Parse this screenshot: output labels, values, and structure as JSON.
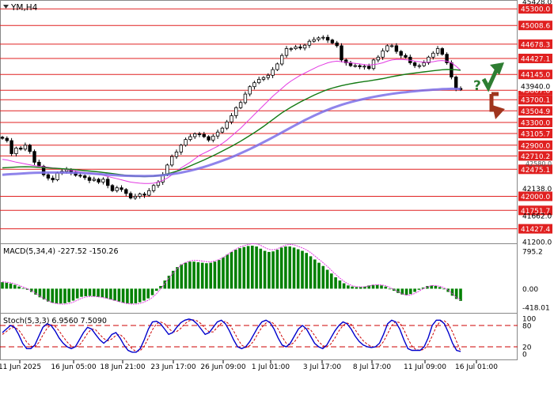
{
  "chart_data": [
    {
      "type": "candlestick",
      "title": "YM,H4",
      "ylim": [
        41200,
        45428
      ],
      "y_ticks": [
        "45428.0",
        "45300.0",
        "45008.6",
        "44678.3",
        "44427.1",
        "44145.0",
        "43867.8",
        "43700.1",
        "43504.9",
        "43300.0",
        "43105.7",
        "42900.0",
        "42710.2",
        "42475.1",
        "42138.0",
        "42000.0",
        "41751.7",
        "41662.0",
        "41427.4",
        "41200.0"
      ],
      "resistance_support_levels": [
        45300.0,
        45008.6,
        44678.3,
        44427.1,
        44145.0,
        43867.8,
        43700.1,
        43504.9,
        43300.0,
        43105.7,
        42900.0,
        42710.2,
        42475.1,
        42000.0,
        41751.7,
        41427.4
      ],
      "current_price_label": "43940.0",
      "hidden_label": "42580.0",
      "x_tick_labels": [
        "11 Jun 2025",
        "16 Jun 05:00",
        "18 Jun 21:00",
        "23 Jun 17:00",
        "26 Jun 09:00",
        "1 Jul 01:00",
        "3 Jul 17:00",
        "8 Jul 17:00",
        "11 Jul 09:00",
        "16 Jul 01:00"
      ],
      "close": [
        43020,
        42980,
        42750,
        42850,
        42830,
        42900,
        42790,
        42600,
        42530,
        42380,
        42320,
        42290,
        42410,
        42440,
        42470,
        42420,
        42370,
        42360,
        42330,
        42280,
        42300,
        42250,
        42300,
        42190,
        42100,
        42150,
        42120,
        42050,
        41970,
        42000,
        42040,
        42020,
        42100,
        42190,
        42250,
        42380,
        42550,
        42700,
        42780,
        42900,
        43000,
        43050,
        43100,
        43090,
        43050,
        42990,
        43060,
        43130,
        43200,
        43310,
        43420,
        43560,
        43650,
        43800,
        43930,
        44000,
        44060,
        44090,
        44130,
        44230,
        44330,
        44480,
        44600,
        44600,
        44630,
        44610,
        44660,
        44730,
        44760,
        44790,
        44800,
        44750,
        44700,
        44650,
        44400,
        44350,
        44300,
        44300,
        44280,
        44290,
        44250,
        44400,
        44450,
        44560,
        44650,
        44650,
        44550,
        44480,
        44450,
        44350,
        44300,
        44300,
        44350,
        44450,
        44520,
        44600,
        44500,
        44350,
        44100,
        43900,
        43880
      ],
      "series": [
        {
          "name": "MA-fast",
          "color": "#e23ae2",
          "values": [
            42650,
            42640,
            42620,
            42600,
            42585,
            42570,
            42555,
            42540,
            42530,
            42520,
            42510,
            42500,
            42495,
            42485,
            42470,
            42460,
            42445,
            42430,
            42420,
            42410,
            42395,
            42385,
            42370,
            42350,
            42330,
            42310,
            42290,
            42270,
            42250,
            42240,
            42230,
            42225,
            42225,
            42230,
            42250,
            42280,
            42320,
            42380,
            42440,
            42500,
            42550,
            42600,
            42660,
            42720,
            42760,
            42800,
            42840,
            42880,
            42930,
            42990,
            43060,
            43130,
            43200,
            43280,
            43360,
            43440,
            43520,
            43600,
            43680,
            43760,
            43830,
            43900,
            43970,
            44030,
            44080,
            44130,
            44170,
            44210,
            44250,
            44290,
            44320,
            44350,
            44370,
            44380,
            44370,
            44360,
            44350,
            44340,
            44330,
            44320,
            44310,
            44320,
            44330,
            44350,
            44380,
            44400,
            44410,
            44410,
            44405,
            44395,
            44380,
            44370,
            44360,
            44360,
            44370,
            44385,
            44390,
            44380,
            44350,
            44290,
            44220
          ]
        },
        {
          "name": "MA-mid",
          "color": "#137a13",
          "values": [
            42500,
            42505,
            42510,
            42515,
            42518,
            42520,
            42518,
            42515,
            42510,
            42505,
            42500,
            42495,
            42490,
            42485,
            42480,
            42475,
            42470,
            42460,
            42452,
            42445,
            42438,
            42430,
            42420,
            42410,
            42400,
            42390,
            42380,
            42370,
            42362,
            42355,
            42350,
            42348,
            42350,
            42355,
            42365,
            42378,
            42395,
            42415,
            42440,
            42468,
            42500,
            42535,
            42570,
            42605,
            42640,
            42678,
            42715,
            42755,
            42795,
            42838,
            42880,
            42925,
            42970,
            43020,
            43070,
            43120,
            43175,
            43230,
            43290,
            43350,
            43410,
            43470,
            43520,
            43570,
            43615,
            43660,
            43700,
            43740,
            43780,
            43815,
            43850,
            43880,
            43905,
            43928,
            43948,
            43965,
            43980,
            43995,
            44008,
            44020,
            44032,
            44045,
            44058,
            44072,
            44088,
            44105,
            44120,
            44135,
            44148,
            44160,
            44170,
            44180,
            44190,
            44200,
            44210,
            44220,
            44228,
            44232,
            44232,
            44228,
            44220
          ]
        },
        {
          "name": "MA-slow",
          "color": "#7b6ee8",
          "values": [
            42380,
            42385,
            42390,
            42395,
            42400,
            42405,
            42410,
            42413,
            42415,
            42417,
            42418,
            42418,
            42418,
            42418,
            42417,
            42416,
            42414,
            42411,
            42407,
            42403,
            42398,
            42393,
            42387,
            42381,
            42375,
            42370,
            42366,
            42362,
            42360,
            42358,
            42357,
            42356,
            42357,
            42360,
            42365,
            42372,
            42381,
            42391,
            42403,
            42417,
            42433,
            42451,
            42471,
            42493,
            42517,
            42542,
            42568,
            42596,
            42625,
            42656,
            42688,
            42722,
            42757,
            42794,
            42832,
            42871,
            42911,
            42952,
            42994,
            43037,
            43080,
            43124,
            43168,
            43212,
            43255,
            43298,
            43340,
            43380,
            43418,
            43455,
            43490,
            43523,
            43554,
            43583,
            43610,
            43635,
            43658,
            43679,
            43698,
            43716,
            43733,
            43749,
            43764,
            43778,
            43791,
            43803,
            43814,
            43824,
            43833,
            43842,
            43850,
            43858,
            43865,
            43871,
            43877,
            43882,
            43887,
            43890,
            43892,
            43892,
            43890
          ]
        }
      ]
    },
    {
      "type": "bar",
      "title": "MACD(5,34,4) -227.52 -150.26",
      "ylim": [
        -418.01,
        795.2
      ],
      "y_ticks": [
        "795.2",
        "0.00",
        "-418.01"
      ],
      "values": [
        120,
        110,
        95,
        70,
        40,
        10,
        -20,
        -60,
        -110,
        -160,
        -200,
        -240,
        -260,
        -270,
        -275,
        -270,
        -250,
        -220,
        -180,
        -150,
        -140,
        -135,
        -140,
        -150,
        -160,
        -180,
        -200,
        -220,
        -240,
        -260,
        -270,
        -275,
        -270,
        -250,
        -220,
        -180,
        -120,
        -40,
        50,
        150,
        240,
        330,
        400,
        450,
        480,
        500,
        500,
        490,
        480,
        470,
        480,
        500,
        530,
        580,
        630,
        680,
        720,
        750,
        770,
        790,
        795,
        780,
        740,
        700,
        680,
        690,
        720,
        760,
        780,
        780,
        760,
        730,
        700,
        660,
        600,
        540,
        480,
        420,
        350,
        280,
        210,
        150,
        100,
        60,
        40,
        30,
        30,
        40,
        60,
        70,
        70,
        60,
        40,
        0,
        -40,
        -80,
        -110,
        -120,
        -100,
        -60,
        -20,
        20,
        50,
        60,
        50,
        30,
        0,
        -60,
        -130,
        -190,
        -227
      ]
    },
    {
      "type": "line",
      "title": "Stoch(5,3,3) 6.9560 7.5090",
      "ylim": [
        0,
        100
      ],
      "y_ticks": [
        "100",
        "80",
        "20",
        "0"
      ],
      "series": [
        {
          "name": "%K",
          "color": "#0000cc",
          "values": [
            60,
            70,
            80,
            75,
            55,
            30,
            15,
            15,
            25,
            50,
            75,
            85,
            80,
            65,
            45,
            30,
            20,
            15,
            20,
            40,
            60,
            75,
            70,
            55,
            40,
            30,
            40,
            55,
            60,
            45,
            25,
            10,
            5,
            5,
            15,
            40,
            70,
            90,
            92,
            85,
            70,
            55,
            60,
            75,
            88,
            95,
            98,
            95,
            85,
            70,
            55,
            60,
            75,
            90,
            95,
            85,
            65,
            40,
            20,
            15,
            20,
            35,
            55,
            75,
            90,
            95,
            88,
            70,
            45,
            25,
            20,
            30,
            50,
            70,
            80,
            70,
            50,
            30,
            20,
            15,
            25,
            45,
            65,
            80,
            90,
            85,
            70,
            50,
            35,
            25,
            20,
            18,
            20,
            30,
            55,
            85,
            95,
            90,
            70,
            40,
            15,
            10,
            10,
            10,
            20,
            45,
            80,
            95,
            95,
            85,
            60,
            30,
            10,
            7
          ]
        },
        {
          "name": "%D",
          "color": "#cc0000",
          "values": [
            55,
            63,
            72,
            75,
            68,
            52,
            33,
            22,
            20,
            32,
            53,
            72,
            82,
            78,
            65,
            48,
            33,
            22,
            18,
            25,
            40,
            58,
            70,
            68,
            55,
            43,
            37,
            42,
            52,
            55,
            45,
            28,
            14,
            7,
            9,
            22,
            45,
            68,
            85,
            90,
            85,
            72,
            62,
            63,
            72,
            85,
            93,
            96,
            93,
            85,
            72,
            62,
            62,
            75,
            86,
            92,
            83,
            65,
            43,
            25,
            18,
            23,
            37,
            57,
            75,
            87,
            91,
            85,
            70,
            48,
            30,
            25,
            33,
            50,
            67,
            74,
            68,
            52,
            35,
            23,
            20,
            28,
            45,
            65,
            80,
            87,
            83,
            68,
            51,
            37,
            27,
            21,
            19,
            21,
            35,
            57,
            80,
            91,
            88,
            68,
            43,
            22,
            12,
            10,
            13,
            27,
            50,
            77,
            92,
            93,
            83,
            62,
            35,
            8
          ]
        }
      ]
    }
  ]
}
